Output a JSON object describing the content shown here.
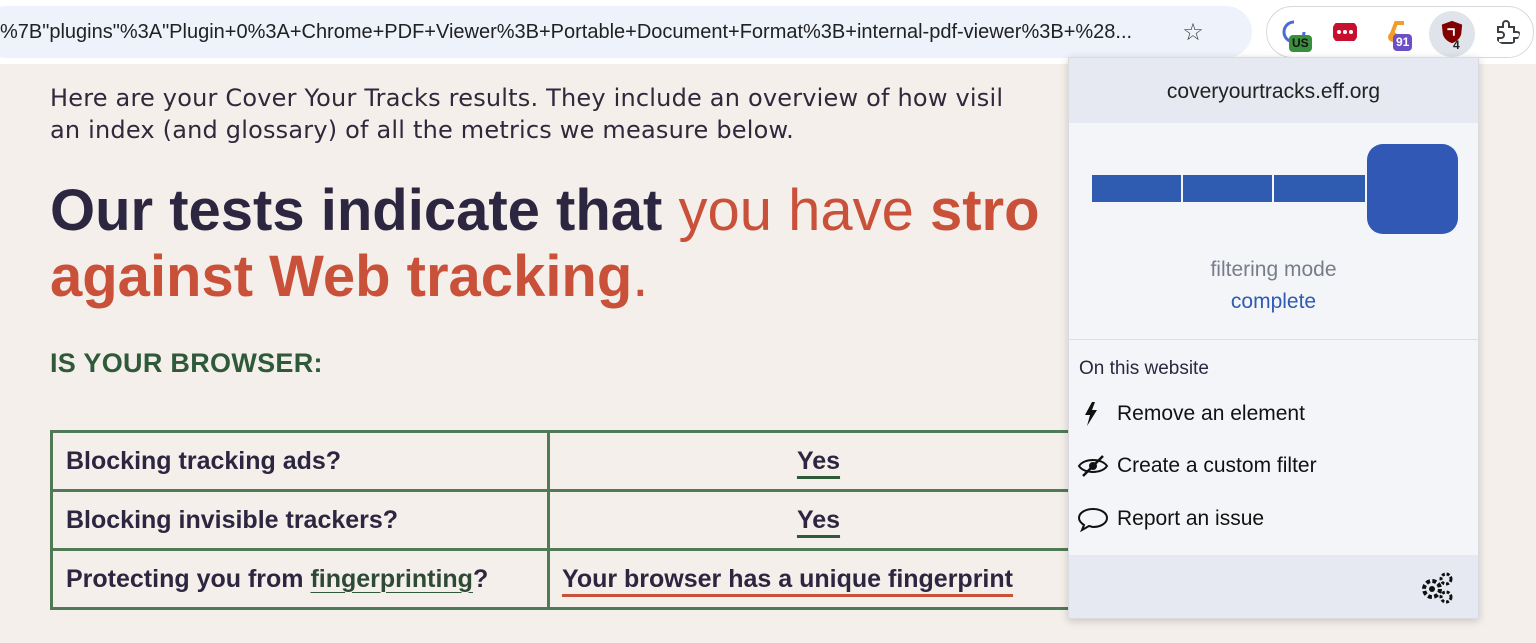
{
  "browser": {
    "url": "%7B\"plugins\"%3A\"Plugin+0%3A+Chrome+PDF+Viewer%3B+Portable+Document+Format%3B+internal-pdf-viewer%3B+%28...",
    "bookmark_icon": "star-icon",
    "extensions": [
      {
        "name": "vpn-extension",
        "icon": "globe-icon",
        "badge": "US",
        "badge_color": "#3a8f3e"
      },
      {
        "name": "lastpass-extension",
        "icon": "dots-icon",
        "badge": "",
        "badge_color": ""
      },
      {
        "name": "tabs-extension",
        "icon": "orange-icon",
        "badge": "91",
        "badge_color": "#6a4fc6"
      },
      {
        "name": "ublock-extension",
        "icon": "shield-icon",
        "badge": "4",
        "badge_color": "#222222"
      },
      {
        "name": "extensions-menu",
        "icon": "puzzle-icon",
        "badge": "",
        "badge_color": ""
      }
    ]
  },
  "page": {
    "intro_line1": "Here are your Cover Your Tracks results. They include an overview of how visil",
    "intro_line2": "an index (and glossary) of all the metrics we measure below.",
    "headline_part1": "Our tests indicate that ",
    "headline_part2": "you have ",
    "headline_part3": "stro",
    "headline_line2": "against Web tracking",
    "headline_period": ".",
    "section_title": "IS YOUR BROWSER:",
    "rows": [
      {
        "question": "Blocking tracking ads?",
        "answer": "Yes"
      },
      {
        "question": "Blocking invisible trackers?",
        "answer": "Yes"
      },
      {
        "question_prefix": "Protecting you from ",
        "question_link": "fingerprinting",
        "question_suffix": "?",
        "answer": "Your browser has a unique fingerprint"
      }
    ]
  },
  "popup": {
    "site": "coveryourtracks.eff.org",
    "filtering_mode_label": "filtering mode",
    "filtering_mode_value": "complete",
    "filtering_level": "4 of 4",
    "section_title": "On this website",
    "items": [
      {
        "label": "Remove an element",
        "icon": "lightning-icon"
      },
      {
        "label": "Create a custom filter",
        "icon": "eye-slash-icon"
      },
      {
        "label": "Report an issue",
        "icon": "comment-icon"
      }
    ],
    "settings_icon": "gears-icon"
  },
  "colors": {
    "accent_red": "#c9513a",
    "accent_green": "#2e5a3a",
    "popup_blue": "#2f5bb0"
  }
}
